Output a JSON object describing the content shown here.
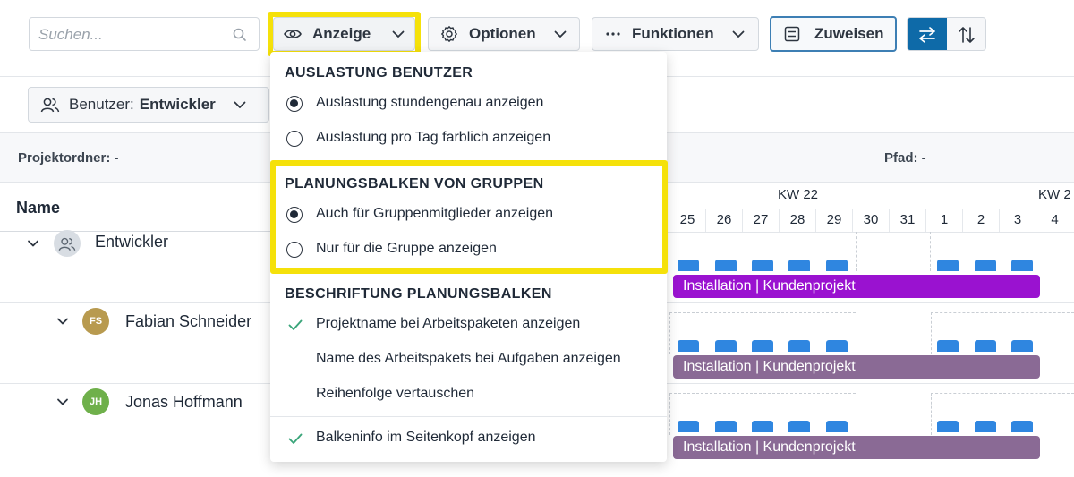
{
  "toolbar": {
    "search_placeholder": "Suchen...",
    "anzeige_label": "Anzeige",
    "optionen_label": "Optionen",
    "funktionen_label": "Funktionen",
    "zuweisen_label": "Zuweisen"
  },
  "filter": {
    "user_prefix": "Benutzer:",
    "user_value": "Entwickler"
  },
  "meta": {
    "projektordner": "Projektordner: -",
    "pfad": "Pfad: -"
  },
  "grid": {
    "name_header": "Name",
    "week_labels": [
      "KW 22",
      "KW 2"
    ],
    "days": [
      "25",
      "26",
      "27",
      "28",
      "29",
      "30",
      "31",
      "1",
      "2",
      "3",
      "4"
    ],
    "rows": [
      {
        "name": "Entwickler",
        "initials": "",
        "avatar_color": "#d8dde3",
        "bar_label": "Installation | Kundenprojekt",
        "bar_color": "#9a12d0"
      },
      {
        "name": "Fabian Schneider",
        "initials": "FS",
        "avatar_color": "#b89a4f",
        "bar_label": "Installation | Kundenprojekt",
        "bar_color": "#8a6a95"
      },
      {
        "name": "Jonas Hoffmann",
        "initials": "JH",
        "avatar_color": "#6fb04b",
        "bar_label": "Installation | Kundenprojekt",
        "bar_color": "#8a6a95"
      }
    ]
  },
  "menu": {
    "section1_title": "AUSLASTUNG BENUTZER",
    "section1_items": [
      "Auslastung stundengenau anzeigen",
      "Auslastung pro Tag farblich anzeigen"
    ],
    "section2_title": "PLANUNGSBALKEN VON GRUPPEN",
    "section2_items": [
      "Auch für Gruppenmitglieder anzeigen",
      "Nur für die Gruppe anzeigen"
    ],
    "section3_title": "BESCHRIFTUNG PLANUNGSBALKEN",
    "section3_items": [
      "Projektname bei Arbeitspaketen anzeigen",
      "Name des Arbeitspakets bei Aufgaben anzeigen",
      "Reihenfolge vertauschen"
    ],
    "footer_item": "Balkeninfo im Seitenkopf anzeigen"
  },
  "colors": {
    "highlight": "#f5e10a",
    "accent": "#0e6aa8",
    "check": "#3aa57a",
    "block": "#2f86e0"
  }
}
